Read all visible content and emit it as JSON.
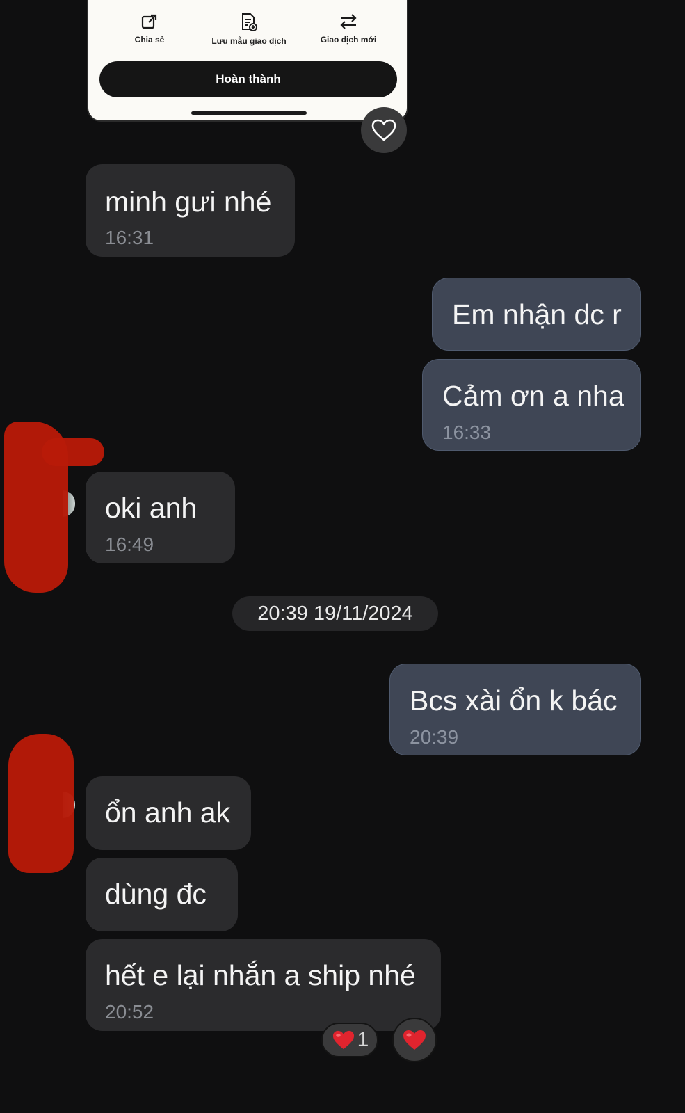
{
  "receipt": {
    "actions": [
      {
        "label": "Chia sẻ",
        "icon": "share-icon"
      },
      {
        "label": "Lưu mẫu giao dịch",
        "icon": "save-template-icon"
      },
      {
        "label": "Giao dịch mới",
        "icon": "swap-arrows-icon"
      }
    ],
    "done_label": "Hoàn thành"
  },
  "messages": [
    {
      "side": "in",
      "text": "minh gưi nhé",
      "time": "16:31"
    },
    {
      "side": "out",
      "text": "Em nhận dc r",
      "time": ""
    },
    {
      "side": "out",
      "text": "Cảm ơn a nha",
      "time": "16:33"
    },
    {
      "side": "in",
      "text": "oki anh",
      "time": "16:49"
    },
    {
      "side": "out",
      "text": "Bcs xài ổn k bác",
      "time": "20:39"
    },
    {
      "side": "in",
      "text": "ổn anh ak",
      "time": ""
    },
    {
      "side": "in",
      "text": "dùng đc",
      "time": ""
    },
    {
      "side": "in",
      "text": "hết e lại nhắn a ship nhé",
      "time": "20:52"
    }
  ],
  "date_separator": "20:39 19/11/2024",
  "reactions": {
    "heart_count": "1",
    "heart_color": "#e0242e"
  },
  "colors": {
    "background": "#0f0f10",
    "incoming_bubble": "#2b2b2d",
    "outgoing_bubble": "#3f4655",
    "redaction": "#b81a08"
  }
}
